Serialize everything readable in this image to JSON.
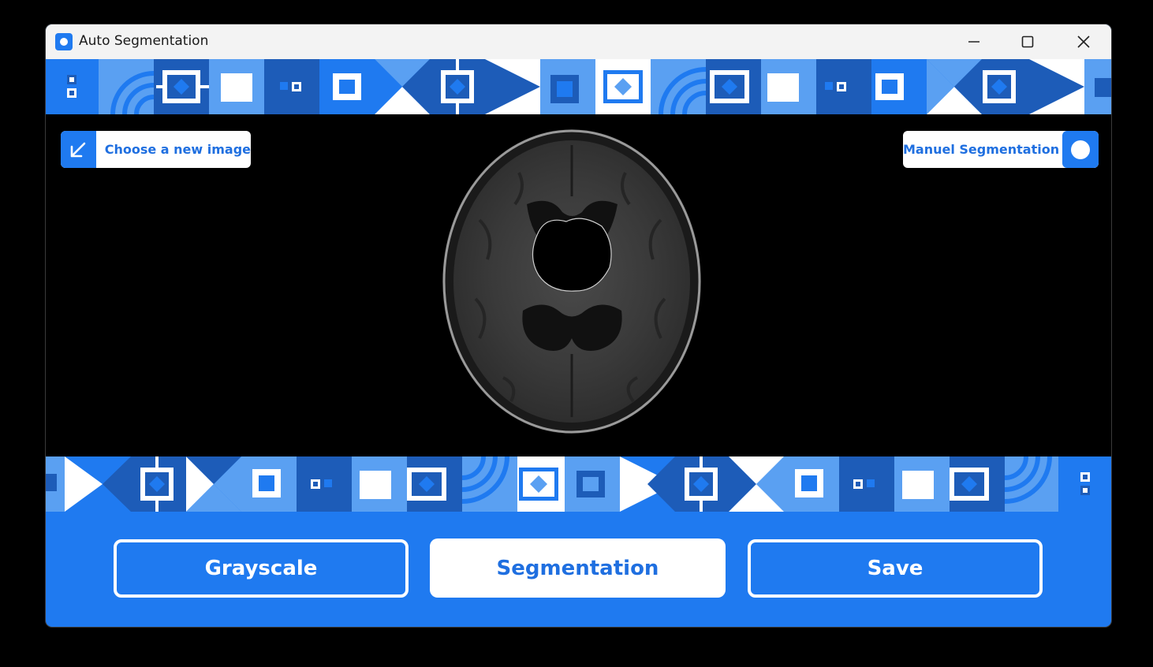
{
  "window": {
    "title": "Auto Segmentation",
    "controls": {
      "minimize_icon": "minimize-icon",
      "maximize_icon": "maximize-icon",
      "close_icon": "close-icon"
    }
  },
  "theme": {
    "accent": "#1f7af0",
    "accent_dark": "#1d5cb8",
    "accent_light": "#5aa0f2",
    "viewer_bg": "#000000"
  },
  "viewer": {
    "choose_button_label": "Choose a new image",
    "choose_button_icon": "arrow-down-left-icon",
    "manual_toggle_label": "Manuel Segmentation"
  },
  "actions": {
    "grayscale_label": "Grayscale",
    "segmentation_label": "Segmentation",
    "save_label": "Save"
  }
}
